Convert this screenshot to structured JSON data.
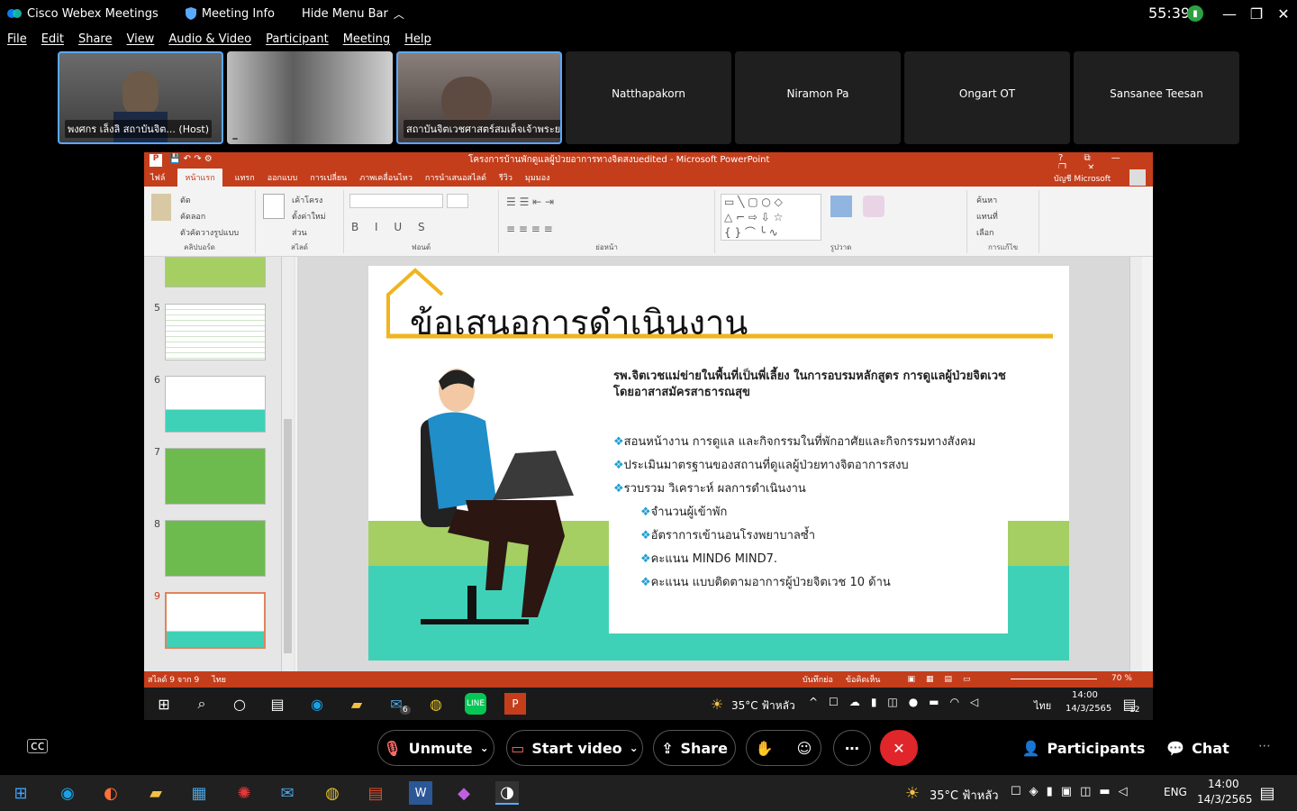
{
  "webex": {
    "app_name": "Cisco Webex Meetings",
    "meeting_info": "Meeting Info",
    "hide_menu": "Hide Menu Bar",
    "timer": "55:39",
    "menu": [
      "File",
      "Edit",
      "Share",
      "View",
      "Audio & Video",
      "Participant",
      "Meeting",
      "Help"
    ],
    "participants": [
      {
        "caption": "พงศกร เล็งลิ สถาบันจิต... (Host)"
      },
      {
        "caption": ""
      },
      {
        "caption": "สถาบันจิตเวชศาสตร์สมเด็จเจ้าพระย..."
      },
      {
        "name": "Natthapakorn"
      },
      {
        "name": "Niramon Pa"
      },
      {
        "name": "Ongart OT"
      },
      {
        "name": "Sansanee Teesan"
      }
    ],
    "controls": {
      "unmute": "Unmute",
      "start_video": "Start video",
      "share": "Share",
      "participants": "Participants",
      "chat": "Chat"
    }
  },
  "ppt": {
    "title": "โครงการบ้านพักดูแลผู้ป่วยอาการทางจิตสงบedited  -  Microsoft PowerPoint",
    "tabs": [
      "ไฟล์",
      "หน้าแรก",
      "แทรก",
      "ออกแบบ",
      "การเปลี่ยน",
      "ภาพเคลื่อนไหว",
      "การนำเสนอสไลด์",
      "รีวิว",
      "มุมมอง"
    ],
    "account": "บัญชี Microsoft",
    "ribbon_groups": [
      "คลิปบอร์ด",
      "สไลด์",
      "ฟอนต์",
      "ย่อหน้า",
      "รูปวาด",
      "การแก้ไข"
    ],
    "ribbon_clip": [
      "ตัด",
      "คัดลอก",
      "ตัวคัดวางรูปแบบ"
    ],
    "ribbon_slide": [
      "เค้าโครง",
      "ตั้งค่าใหม่",
      "ส่วน"
    ],
    "ribbon_edit": [
      "ค้นหา",
      "แทนที่",
      "เลือก"
    ],
    "slide_numbers": [
      "5",
      "6",
      "7",
      "8",
      "9"
    ],
    "slide": {
      "title": "ข้อเสนอการดำเนินงาน",
      "subtitle": "รพ.จิตเวชแม่ข่ายในพื้นที่เป็นพี่เลี้ยง ในการอบรมหลักสูตร การดูแลผู้ป่วยจิตเวชโดยอาสาสมัครสาธารณสุข",
      "bullets": [
        "สอนหน้างาน การดูแล และกิจกรรมในที่พักอาศัยและกิจกรรมทางสังคม",
        "ประเมินมาตรฐานของสถานที่ดูแลผู้ป่วยทางจิตอาการสงบ",
        "รวบรวม วิเคราะห์ ผลการดำเนินงาน"
      ],
      "sub_bullets": [
        "จำนวนผู้เข้าพัก",
        "อัตราการเข้านอนโรงพยาบาลซ้ำ",
        "คะแนน MIND6   MIND7.",
        "คะแนน แบบติดตามอาการผู้ป่วยจิตเวช 10 ด้าน"
      ]
    },
    "status": {
      "slide_count": "สไลด์ 9 จาก 9",
      "lang": "ไทย",
      "notes": "บันทึกย่อ",
      "comments": "ข้อคิดเห็น",
      "zoom": "70 %"
    },
    "inner_taskbar": {
      "weather": "35°C  ฟ้าหลัว",
      "lang": "ไทย",
      "time": "14:00",
      "date": "14/3/2565",
      "mail_badge": "6",
      "notif_badge": "12"
    }
  },
  "taskbar": {
    "weather": "35°C  ฟ้าหลัว",
    "lang": "ENG",
    "time": "14:00",
    "date": "14/3/2565"
  },
  "colors": {
    "ppt_accent": "#c43e1c",
    "slide_green": "#a5cf63",
    "slide_teal": "#3fd1b7",
    "house_yellow": "#f0b51e",
    "end_call": "#e0262a"
  }
}
